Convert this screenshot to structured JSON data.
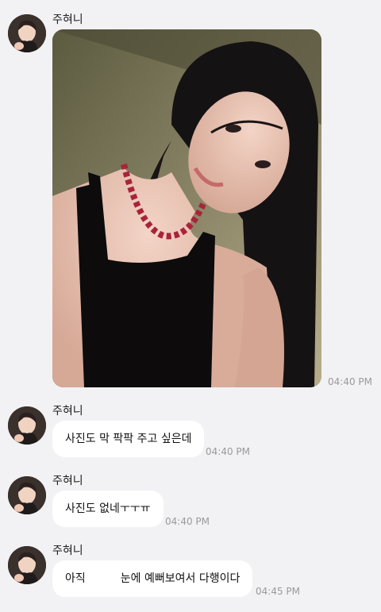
{
  "messages": [
    {
      "sender": "주혀니",
      "type": "image",
      "time": "04:40 PM"
    },
    {
      "sender": "주혀니",
      "type": "text",
      "text": "사진도 막 팍팍 주고 싶은데",
      "time": "04:40 PM"
    },
    {
      "sender": "주혀니",
      "type": "text",
      "text": "사진도 없네ㅜㅜㅠ",
      "time": "04:40 PM"
    },
    {
      "sender": "주혀니",
      "type": "text",
      "text_before": "아직",
      "text_after": "눈에 예뻐보여서 다행이다",
      "time": "04:45 PM"
    }
  ],
  "colors": {
    "background": "#f2f2f4",
    "bubble": "#ffffff",
    "timestamp": "#9a9a9e"
  },
  "icons": {
    "avatar": "profile-photo"
  }
}
